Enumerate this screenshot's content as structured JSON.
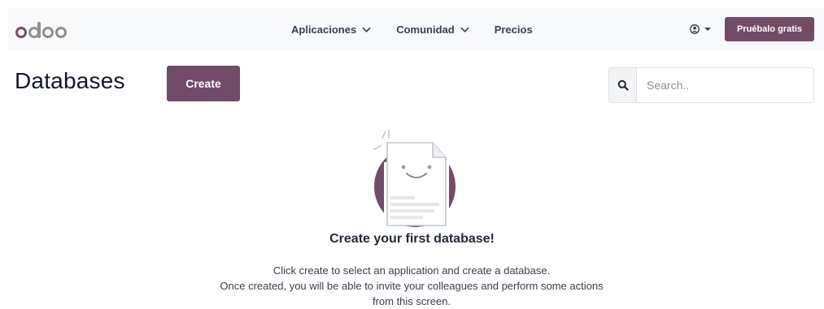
{
  "navbar": {
    "logo_text": "odoo",
    "links": [
      {
        "label": "Aplicaciones",
        "dropdown": true
      },
      {
        "label": "Comunidad",
        "dropdown": true
      },
      {
        "label": "Precios",
        "dropdown": false
      }
    ],
    "user_icon": "user-circle-icon",
    "try_button": "Pruébalo gratis"
  },
  "main": {
    "title": "Databases",
    "create_button": "Create",
    "search": {
      "placeholder": "Search..",
      "value": "",
      "icon": "search-icon"
    }
  },
  "empty_state": {
    "illustration": "smiling-document-icon",
    "title": "Create your first database!",
    "lines": [
      "Click create to select an application and create a database.",
      "Once created, you will be able to invite your colleagues and perform some actions",
      "from this screen."
    ]
  },
  "colors": {
    "brand": "#714b67",
    "navbar_bg": "#f8f9fa",
    "logo_gray": "#8f8f8f"
  }
}
